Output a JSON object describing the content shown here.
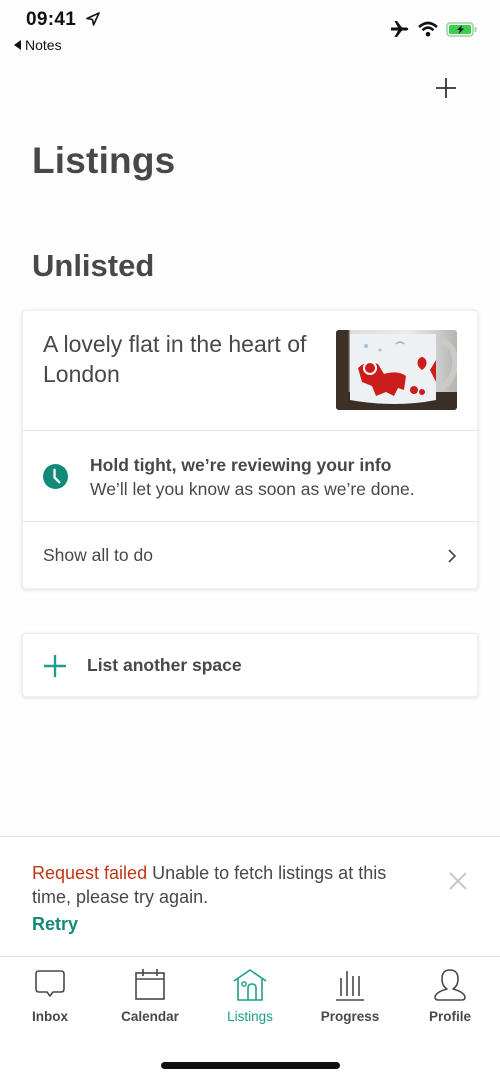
{
  "status_bar": {
    "time": "09:41",
    "back_app": "Notes",
    "icons": [
      "location-arrow-icon",
      "airplane-icon",
      "wifi-icon",
      "battery-charging-icon"
    ]
  },
  "header": {
    "add_icon": "plus-icon",
    "title": "Listings"
  },
  "section": {
    "title": "Unlisted"
  },
  "listing": {
    "name": "A lovely flat in the heart of London",
    "photo_alt": "Mug with red reindeer print",
    "review": {
      "icon": "clock-icon",
      "title": "Hold tight, we’re reviewing your info",
      "subtitle": "We’ll let you know as soon as we’re done."
    },
    "todo": {
      "label": "Show all to do",
      "icon": "chevron-right-icon"
    }
  },
  "add_space": {
    "label": "List another space",
    "icon": "plus-icon"
  },
  "error": {
    "title": "Request failed",
    "message": " Unable to fetch listings at this time, please try again.",
    "retry_label": "Retry",
    "close_icon": "close-icon"
  },
  "tabs": [
    {
      "label": "Inbox",
      "icon": "chat-bubble-icon",
      "active": false
    },
    {
      "label": "Calendar",
      "icon": "calendar-icon",
      "active": false
    },
    {
      "label": "Listings",
      "icon": "house-icon",
      "active": true
    },
    {
      "label": "Progress",
      "icon": "bar-chart-icon",
      "active": false
    },
    {
      "label": "Profile",
      "icon": "person-icon",
      "active": false
    }
  ],
  "colors": {
    "accent": "#1f9d8a",
    "error": "#c13515",
    "text": "#484848"
  }
}
